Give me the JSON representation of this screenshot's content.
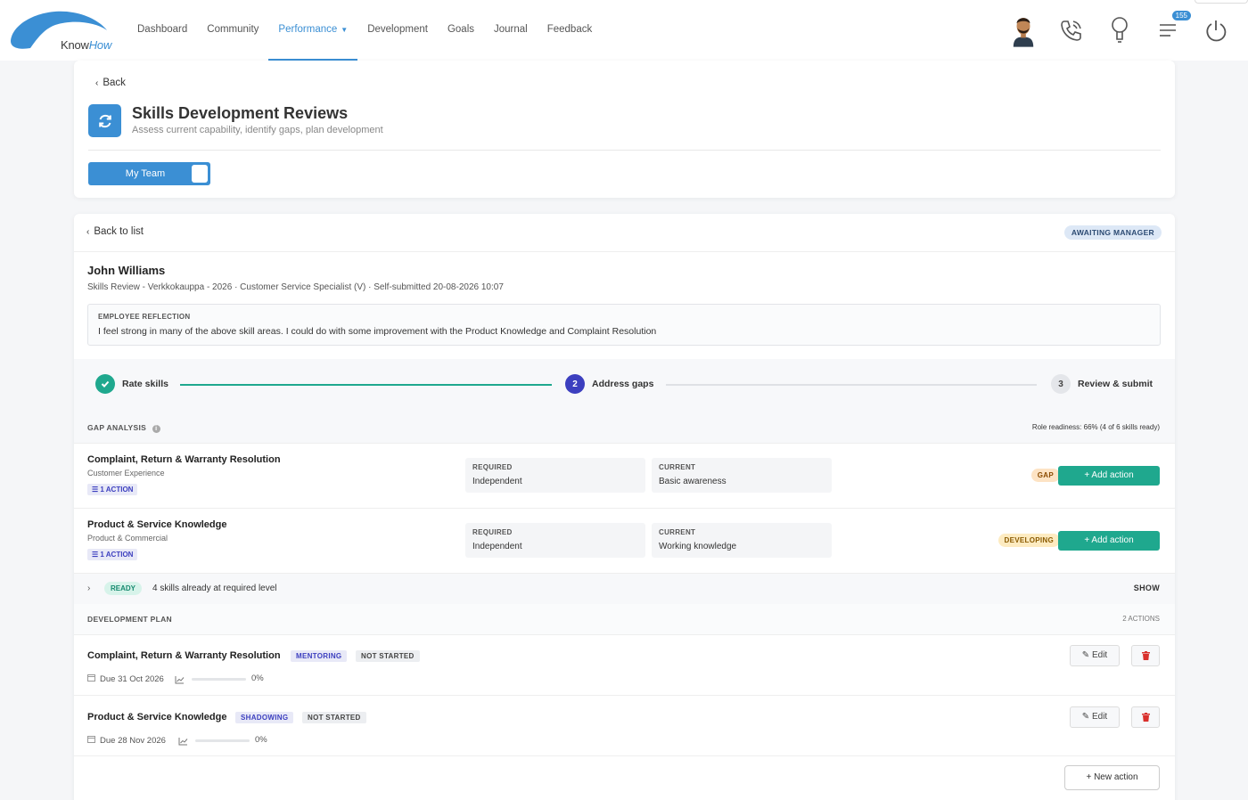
{
  "brand": {
    "logo_text_1": "Know",
    "logo_text_2": "How",
    "logo_color": "#3b8fd4"
  },
  "nav": {
    "items": [
      {
        "label": "Dashboard"
      },
      {
        "label": "Community"
      },
      {
        "label": "Performance",
        "active": true
      },
      {
        "label": "Development"
      },
      {
        "label": "Goals"
      },
      {
        "label": "Journal"
      },
      {
        "label": "Feedback"
      }
    ],
    "notification_count": "155",
    "icons": [
      "avatar",
      "phone-icon",
      "lightbulb-icon",
      "menu-icon",
      "power-icon"
    ]
  },
  "header": {
    "back_label": "Back",
    "title": "Skills Development Reviews",
    "subtitle": "Assess current capability, identify gaps, plan development",
    "toggle_label": "My Team"
  },
  "review": {
    "back_to_list": "Back to list",
    "status": "AWAITING MANAGER",
    "employee_name": "John Williams",
    "meta": "Skills Review - Verkkokauppa - 2026 · Customer Service Specialist (V) · Self-submitted 20-08-2026 10:07",
    "reflection_label": "EMPLOYEE REFLECTION",
    "reflection_text": "I feel strong in many of the above skill areas. I could do with some improvement with the Product Knowledge and Complaint Resolution"
  },
  "steps": [
    {
      "num": "✓",
      "label": "Rate skills",
      "state": "done"
    },
    {
      "num": "2",
      "label": "Address gaps",
      "state": "current"
    },
    {
      "num": "3",
      "label": "Review & submit",
      "state": "todo"
    }
  ],
  "gap_analysis": {
    "title": "GAP ANALYSIS",
    "readiness": "Role readiness: 66% (4 of 6 skills ready)",
    "rows": [
      {
        "skill": "Complaint, Return & Warranty Resolution",
        "category": "Customer Experience",
        "actions": "1 ACTION",
        "required_label": "REQUIRED",
        "required": "Independent",
        "current_label": "CURRENT",
        "current": "Basic awareness",
        "status": "GAP",
        "add_label": "+ Add action"
      },
      {
        "skill": "Product & Service Knowledge",
        "category": "Product & Commercial",
        "actions": "1 ACTION",
        "required_label": "REQUIRED",
        "required": "Independent",
        "current_label": "CURRENT",
        "current": "Working knowledge",
        "status": "DEVELOPING",
        "add_label": "+ Add action"
      }
    ],
    "ready_label": "READY",
    "ready_text": "4 skills already at required level",
    "show_label": "SHOW"
  },
  "development_plan": {
    "title": "DEVELOPMENT PLAN",
    "count": "2 ACTIONS",
    "items": [
      {
        "skill": "Complaint, Return & Warranty Resolution",
        "type": "MENTORING",
        "status": "NOT STARTED",
        "due": "Due 31 Oct 2026",
        "progress": 0,
        "progress_label": "0%",
        "edit_label": "Edit"
      },
      {
        "skill": "Product & Service Knowledge",
        "type": "SHADOWING",
        "status": "NOT STARTED",
        "due": "Due 28 Nov 2026",
        "progress": 0,
        "progress_label": "0%",
        "edit_label": "Edit"
      }
    ],
    "new_action_label": "+ New action"
  },
  "colors": {
    "accent": "#3b8fd4",
    "teal": "#1fa88e",
    "indigo": "#3c3fbf",
    "danger": "#d9302c"
  }
}
